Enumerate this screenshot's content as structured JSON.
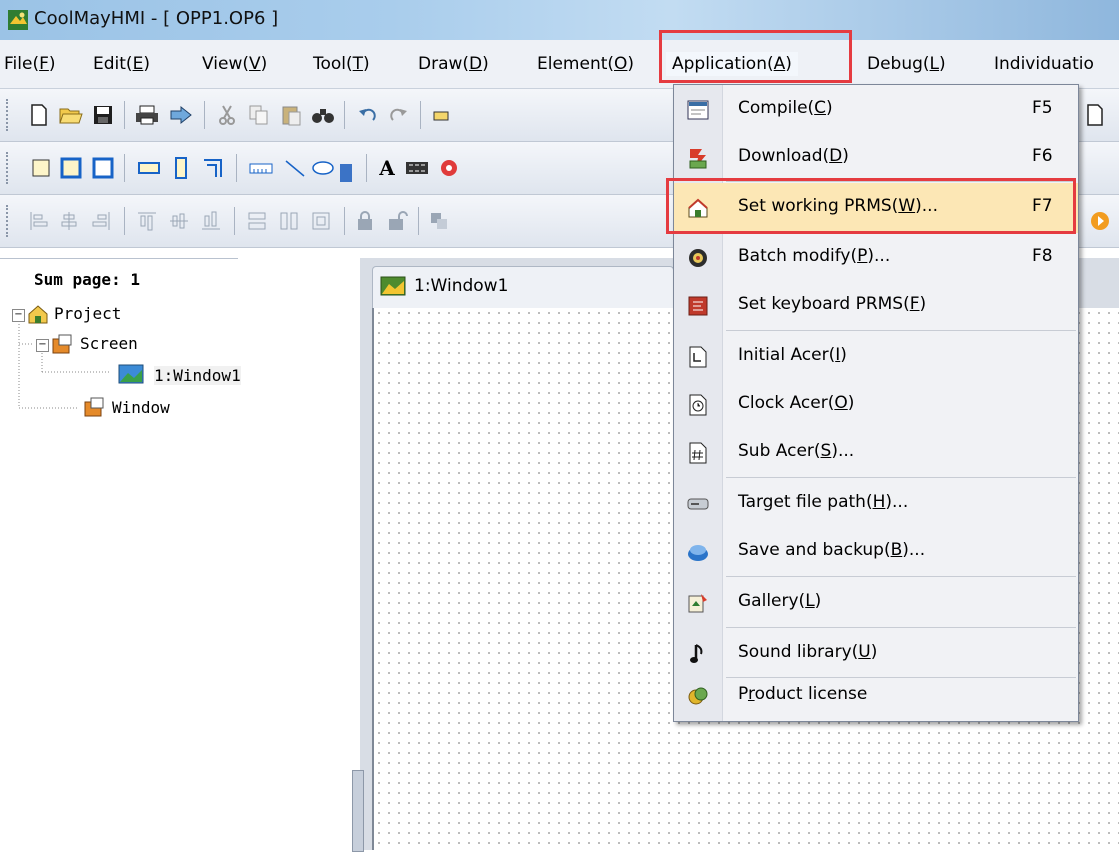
{
  "window": {
    "title": "CoolMayHMI - [ OPP1.OP6 ]"
  },
  "menubar": {
    "items": [
      {
        "label": "File(",
        "key": "F",
        "end": ")"
      },
      {
        "label": "Edit(",
        "key": "E",
        "end": ")"
      },
      {
        "label": "View(",
        "key": "V",
        "end": ")"
      },
      {
        "label": "Tool(",
        "key": "T",
        "end": ")"
      },
      {
        "label": "Draw(",
        "key": "D",
        "end": ")"
      },
      {
        "label": "Element(",
        "key": "O",
        "end": ")"
      },
      {
        "label": "Application(",
        "key": "A",
        "end": ")"
      },
      {
        "label": "Debug(",
        "key": "L",
        "end": ")"
      },
      {
        "label": "Individuatio",
        "key": "",
        "end": ""
      }
    ]
  },
  "left_panel": {
    "sum_page": "Sum page: 1",
    "tree": {
      "project": "Project",
      "screen": "Screen",
      "window1": "1:Window1",
      "window": "Window"
    }
  },
  "document": {
    "tab_title": "1:Window1"
  },
  "toolbar2": {
    "text_icon": "A"
  },
  "dropdown": {
    "items": [
      {
        "pre": "Compile(",
        "key": "C",
        "post": ")",
        "shortcut": "F5",
        "icon": "compile-icon"
      },
      {
        "pre": "Download(",
        "key": "D",
        "post": ")",
        "shortcut": "F6",
        "icon": "download-icon"
      },
      {
        "pre": "Set working PRMS(",
        "key": "W",
        "post": ")...",
        "shortcut": "F7",
        "icon": "home-icon"
      },
      {
        "pre": "Batch modify(",
        "key": "P",
        "post": ")...",
        "shortcut": "F8",
        "icon": "batch-icon"
      },
      {
        "pre": "Set keyboard PRMS(",
        "key": "F",
        "post": ")",
        "shortcut": "",
        "icon": "keyboard-icon"
      },
      {
        "pre": "Initial Acer(",
        "key": "I",
        "post": ")",
        "shortcut": "",
        "icon": "initial-icon"
      },
      {
        "pre": "Clock Acer(",
        "key": "O",
        "post": ")",
        "shortcut": "",
        "icon": "clock-icon"
      },
      {
        "pre": "Sub Acer(",
        "key": "S",
        "post": ")...",
        "shortcut": "",
        "icon": "hash-icon"
      },
      {
        "pre": "Target file path(",
        "key": "H",
        "post": ")...",
        "shortcut": "",
        "icon": "drive-icon"
      },
      {
        "pre": "Save and backup(",
        "key": "B",
        "post": ")...",
        "shortcut": "",
        "icon": "backup-icon"
      },
      {
        "pre": "Gallery(",
        "key": "L",
        "post": ")",
        "shortcut": "",
        "icon": "gallery-icon"
      },
      {
        "pre": "Sound library(",
        "key": "U",
        "post": ")",
        "shortcut": "",
        "icon": "music-note-icon"
      },
      {
        "pre": "P",
        "key": "r",
        "post": "oduct license",
        "shortcut": "",
        "icon": "license-icon"
      }
    ],
    "highlighted_index": 2
  },
  "colors": {
    "highlight_border": "#e53b40",
    "menu_highlight": "#fce7b5"
  }
}
